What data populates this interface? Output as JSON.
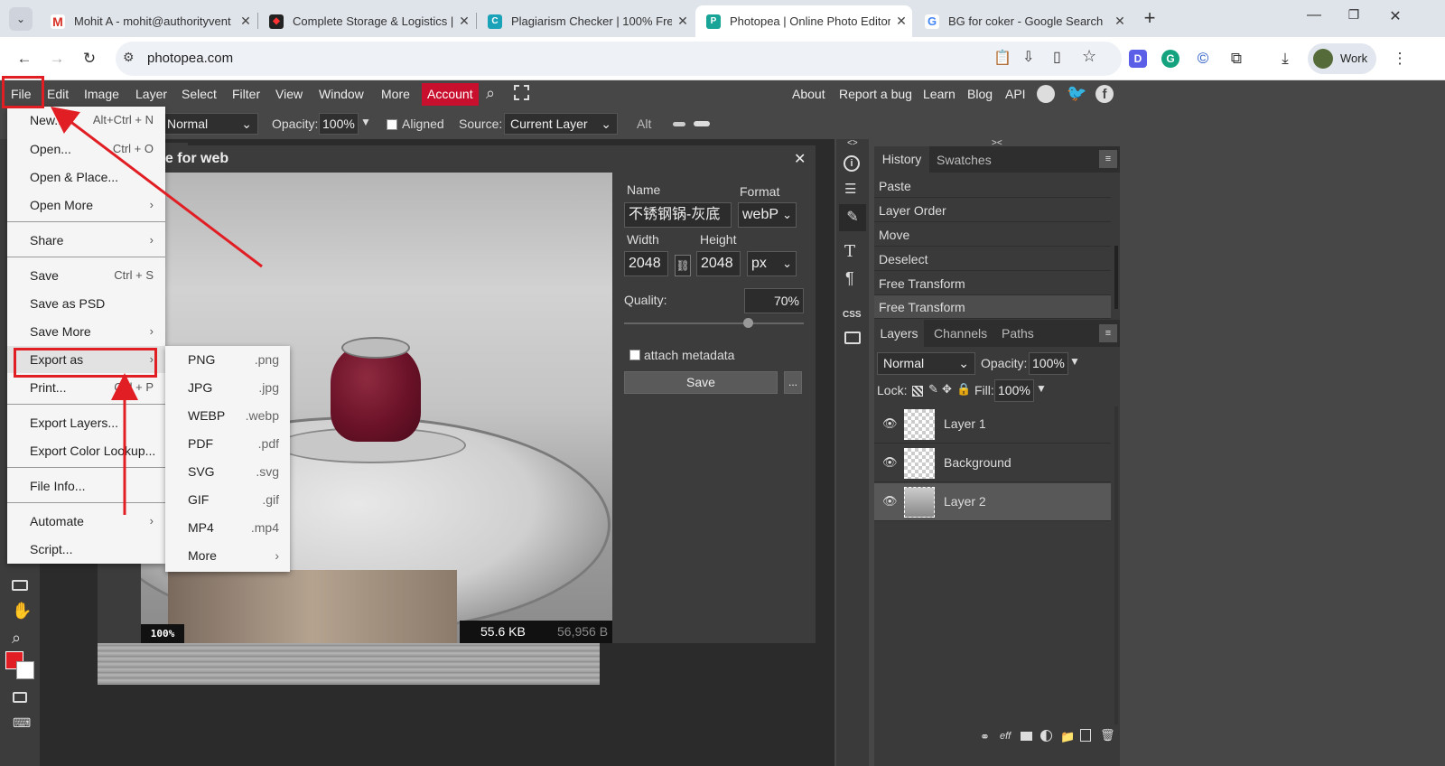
{
  "browser": {
    "tabs": [
      {
        "title": "Mohit A - mohit@authorityvent",
        "icon": "gmail-icon"
      },
      {
        "title": "Complete Storage & Logistics |",
        "icon": "site-icon"
      },
      {
        "title": "Plagiarism Checker | 100% Free",
        "icon": "checker-icon"
      },
      {
        "title": "Photopea | Online Photo Editor",
        "icon": "photopea-icon"
      },
      {
        "title": "BG for coker - Google Search",
        "icon": "google-icon"
      }
    ],
    "url": "photopea.com",
    "profile_label": "Work",
    "accent": "#e01e24"
  },
  "menubar": {
    "items": [
      "File",
      "Edit",
      "Image",
      "Layer",
      "Select",
      "Filter",
      "View",
      "Window",
      "More"
    ],
    "account": "Account",
    "right_links": [
      "About",
      "Report a bug",
      "Learn",
      "Blog",
      "API"
    ]
  },
  "toolopts": {
    "blend": "Normal",
    "opacity_label": "Opacity:",
    "opacity": "100%",
    "aligned": "Aligned",
    "source_label": "Source:",
    "source": "Current Layer",
    "alt": "Alt"
  },
  "dialog": {
    "title": "ve for web",
    "name_label": "Name",
    "name": "不锈钢锅-灰底",
    "format_label": "Format",
    "format": "webP",
    "width_label": "Width",
    "width": "2048",
    "height_label": "Height",
    "height": "2048",
    "unit": "px",
    "quality_label": "Quality:",
    "quality": "70%",
    "quality_level": 0.7,
    "metadata": "attach metadata",
    "save": "Save",
    "more": "...",
    "zoom": "100%",
    "size_kb": "55.6 KB",
    "size_b": "56,956 B",
    "close": "✕"
  },
  "file_menu": {
    "items": [
      {
        "label": "New...",
        "shortcut": "Alt+Ctrl + N"
      },
      {
        "label": "Open...",
        "shortcut": "Ctrl + O"
      },
      {
        "label": "Open & Place...",
        "shortcut": ""
      },
      {
        "label": "Open More",
        "shortcut": "›"
      },
      {
        "label": "Share",
        "shortcut": "›"
      },
      {
        "label": "Save",
        "shortcut": "Ctrl + S"
      },
      {
        "label": "Save as PSD",
        "shortcut": ""
      },
      {
        "label": "Save More",
        "shortcut": "›"
      },
      {
        "label": "Export as",
        "shortcut": "›"
      },
      {
        "label": "Print...",
        "shortcut": "Ctrl + P"
      },
      {
        "label": "Export Layers...",
        "shortcut": ""
      },
      {
        "label": "Export Color Lookup...",
        "shortcut": ""
      },
      {
        "label": "File Info...",
        "shortcut": ""
      },
      {
        "label": "Automate",
        "shortcut": "›"
      },
      {
        "label": "Script...",
        "shortcut": ""
      }
    ]
  },
  "export_menu": {
    "items": [
      {
        "label": "PNG",
        "ext": ".png"
      },
      {
        "label": "JPG",
        "ext": ".jpg"
      },
      {
        "label": "WEBP",
        "ext": ".webp"
      },
      {
        "label": "PDF",
        "ext": ".pdf"
      },
      {
        "label": "SVG",
        "ext": ".svg"
      },
      {
        "label": "GIF",
        "ext": ".gif"
      },
      {
        "label": "MP4",
        "ext": ".mp4"
      },
      {
        "label": "More",
        "ext": "›"
      }
    ]
  },
  "history": {
    "tabs": [
      "History",
      "Swatches"
    ],
    "items": [
      "Paste",
      "Layer Order",
      "Move",
      "Deselect",
      "Free Transform",
      "Free Transform"
    ]
  },
  "layers": {
    "tabs": [
      "Layers",
      "Channels",
      "Paths"
    ],
    "blend": "Normal",
    "opacity_label": "Opacity:",
    "opacity": "100%",
    "lock_label": "Lock:",
    "fill_label": "Fill:",
    "fill": "100%",
    "items": [
      "Layer 1",
      "Background",
      "Layer 2"
    ],
    "footer_eff": "eff"
  },
  "right_strip_labels": {
    "css": "CSS"
  },
  "collapse": {
    "left": "<>",
    "right": "><"
  }
}
